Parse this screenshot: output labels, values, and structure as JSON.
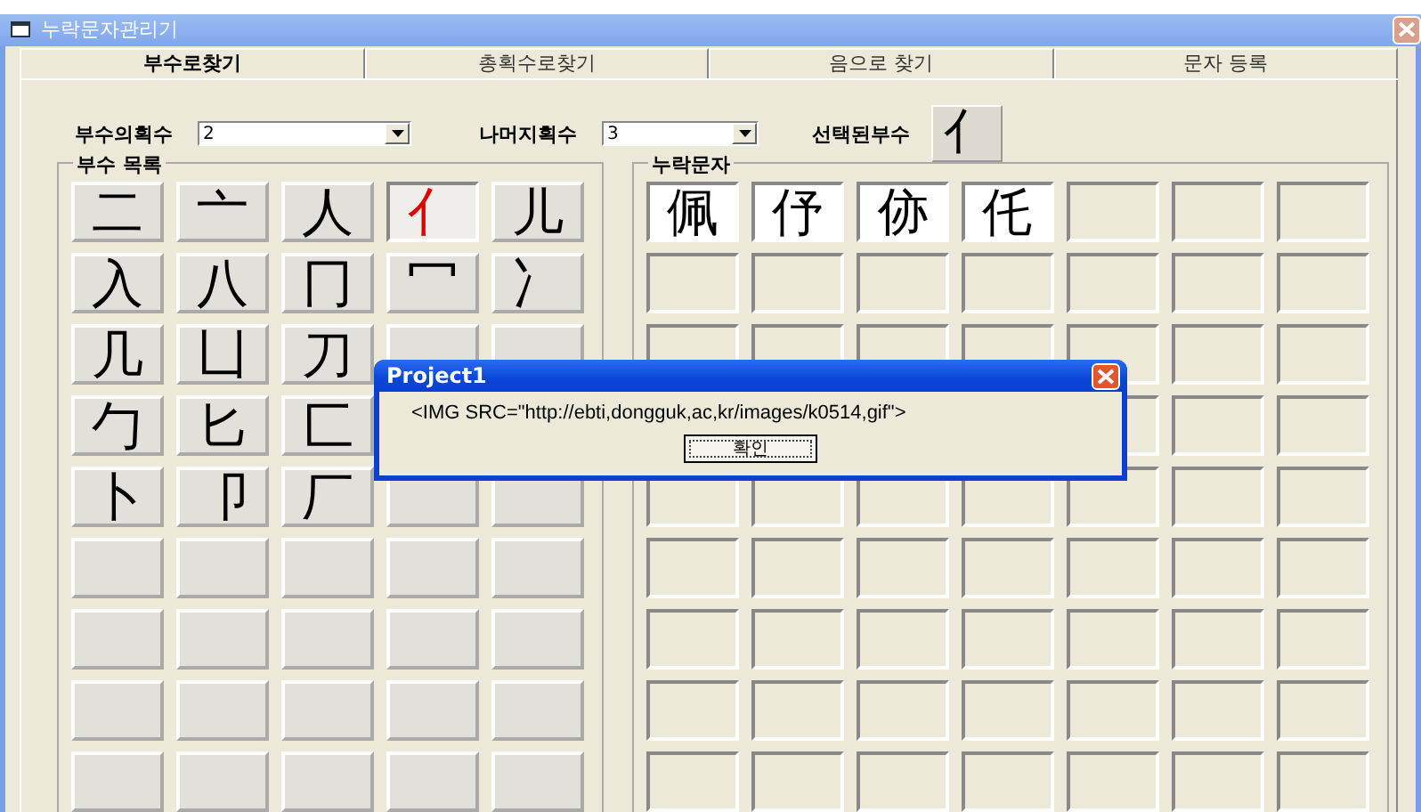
{
  "window": {
    "title": "누락문자관리기"
  },
  "tabs": [
    {
      "label": "부수로찾기",
      "selected": true
    },
    {
      "label": "총획수로찾기",
      "selected": false
    },
    {
      "label": "음으로 찾기",
      "selected": false
    },
    {
      "label": "문자 등록",
      "selected": false
    }
  ],
  "filters": {
    "radical_strokes": {
      "label": "부수의획수",
      "value": "2"
    },
    "remaining_strokes": {
      "label": "나머지획수",
      "value": "3"
    },
    "selected_radical": {
      "label": "선택된부수",
      "value": "亻"
    }
  },
  "radical_list": {
    "title": "부수 목록",
    "cells": [
      {
        "char": "二",
        "selected": false
      },
      {
        "char": "亠",
        "selected": false
      },
      {
        "char": "人",
        "selected": false
      },
      {
        "char": "亻",
        "selected": true
      },
      {
        "char": "儿",
        "selected": false
      },
      {
        "char": "入",
        "selected": false
      },
      {
        "char": "八",
        "selected": false
      },
      {
        "char": "冂",
        "selected": false
      },
      {
        "char": "冖",
        "selected": false
      },
      {
        "char": "冫",
        "selected": false
      },
      {
        "char": "几",
        "selected": false
      },
      {
        "char": "凵",
        "selected": false
      },
      {
        "char": "刀",
        "selected": false
      },
      {},
      {},
      {
        "char": "勹",
        "selected": false
      },
      {
        "char": "匕",
        "selected": false
      },
      {
        "char": "匚",
        "selected": false
      },
      null,
      null,
      {
        "char": "卜",
        "selected": false
      },
      {
        "char": "卩",
        "selected": false
      },
      {
        "char": "厂",
        "selected": false
      },
      {},
      {}
    ]
  },
  "missing_chars": {
    "title": "누락문자",
    "items": [
      "佩",
      "伃",
      "㑊",
      "仛"
    ]
  },
  "dialog": {
    "title": "Project1",
    "message": "<IMG SRC=\"http://ebti,dongguk,ac,kr/images/k0514,gif\">",
    "button": "확인"
  }
}
